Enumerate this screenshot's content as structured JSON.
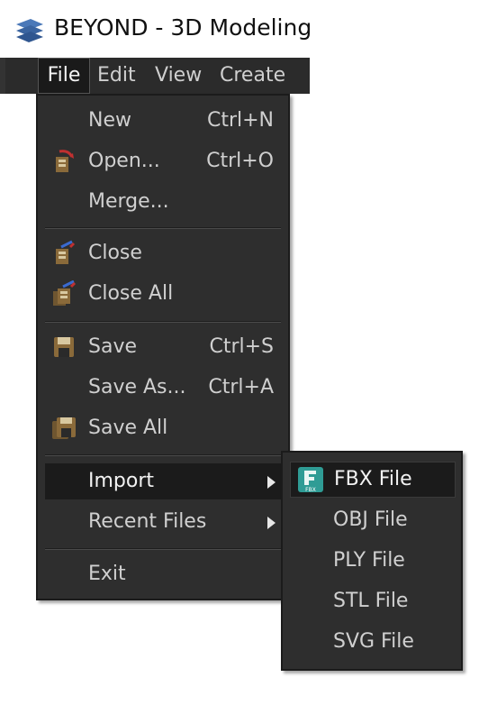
{
  "window": {
    "title": "BEYOND - 3D Modeling"
  },
  "menubar": {
    "items": [
      {
        "label": "File",
        "active": true
      },
      {
        "label": "Edit"
      },
      {
        "label": "View"
      },
      {
        "label": "Create"
      }
    ]
  },
  "file_menu": {
    "items": [
      {
        "label": "New",
        "shortcut": "Ctrl+N",
        "icon": null
      },
      {
        "label": "Open...",
        "shortcut": "Ctrl+O",
        "icon": "open-icon"
      },
      {
        "label": "Merge...",
        "shortcut": "",
        "icon": null
      },
      {
        "label": "Close",
        "shortcut": "",
        "icon": "close-file-icon"
      },
      {
        "label": "Close All",
        "shortcut": "",
        "icon": "close-all-icon"
      },
      {
        "label": "Save",
        "shortcut": "Ctrl+S",
        "icon": "save-icon"
      },
      {
        "label": "Save As...",
        "shortcut": "Ctrl+A",
        "icon": null
      },
      {
        "label": "Save All",
        "shortcut": "",
        "icon": "save-all-icon"
      },
      {
        "label": "Import",
        "shortcut": "",
        "submenu": true,
        "highlighted": true
      },
      {
        "label": "Recent Files",
        "shortcut": "",
        "submenu": true
      },
      {
        "label": "Exit",
        "shortcut": ""
      }
    ]
  },
  "import_menu": {
    "items": [
      {
        "label": "FBX File",
        "icon": "fbx-icon",
        "icon_text": "FBX",
        "highlighted": true
      },
      {
        "label": "OBJ File"
      },
      {
        "label": "PLY File"
      },
      {
        "label": "STL File"
      },
      {
        "label": "SVG File"
      }
    ]
  },
  "colors": {
    "menu_bg": "#2e2e2e",
    "highlight_bg": "#1b1b1b",
    "text": "#d0d0d0",
    "fbx_teal": "#2f9c95"
  }
}
